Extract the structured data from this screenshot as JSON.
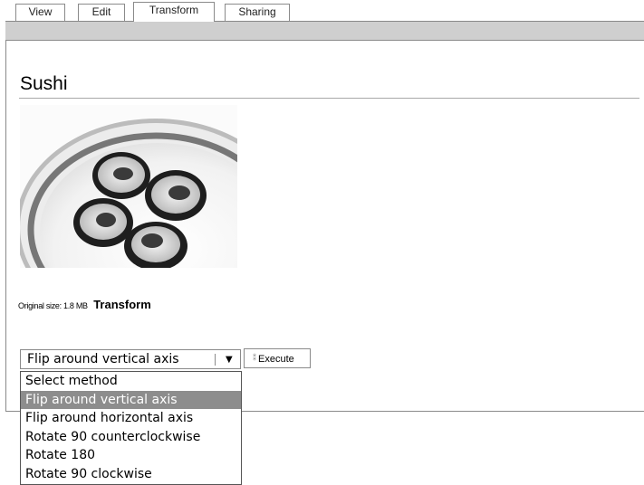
{
  "tabs": [
    {
      "label": "View",
      "active": false
    },
    {
      "label": "Edit",
      "active": false
    },
    {
      "label": "Transform",
      "active": true
    },
    {
      "label": "Sharing",
      "active": false
    }
  ],
  "page": {
    "title": "Sushi",
    "original_size_label": "Original size: 1.8 MB",
    "transform_label": "Transform"
  },
  "transform": {
    "selected_value": "Flip around vertical axis",
    "execute_label": "Execute",
    "options": [
      "Select method",
      "Flip around vertical axis",
      "Flip around horizontal axis",
      "Rotate 90 counterclockwise",
      "Rotate 180",
      "Rotate 90 clockwise"
    ],
    "highlighted_option_index": 1
  },
  "colors": {
    "band": "#cfcfcf",
    "border": "#8a8a8a",
    "highlight": "#8d8d8d"
  }
}
